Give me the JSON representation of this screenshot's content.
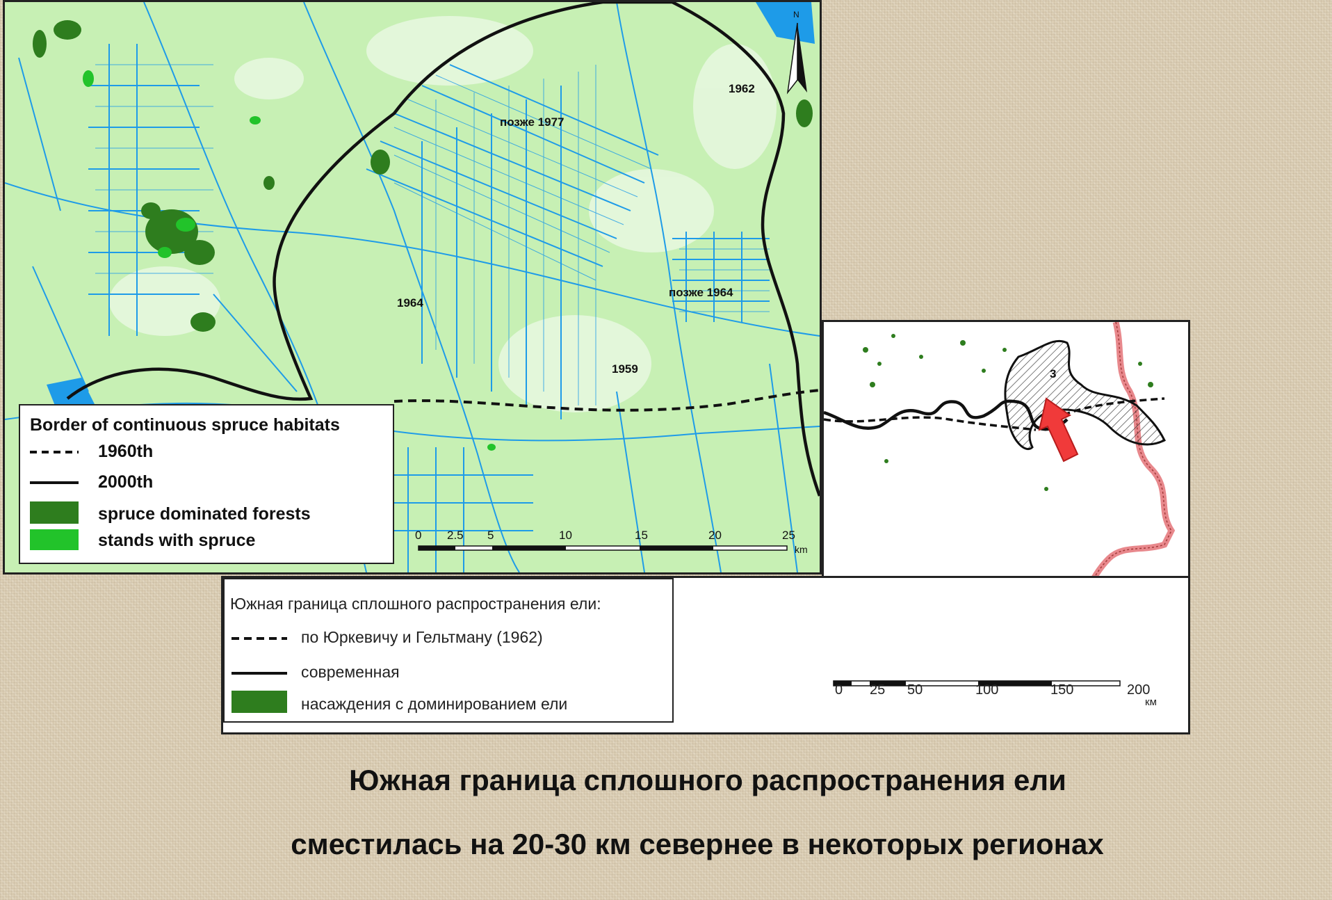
{
  "left_map": {
    "labels": [
      "позже 1977",
      "1962",
      "1964",
      "позже 1964",
      "1959"
    ],
    "north_label": "N",
    "scale": {
      "ticks": [
        "0",
        "2.5",
        "5",
        "10",
        "15",
        "20",
        "25"
      ],
      "unit": "km"
    },
    "legend": {
      "title": "Border of continuous spruce habitats",
      "items": [
        {
          "symbol": "dashed-line",
          "label": "1960th"
        },
        {
          "symbol": "solid-line",
          "label": "2000th"
        },
        {
          "symbol": "swatch",
          "color": "#2e7d1e",
          "label": "spruce dominated forests"
        },
        {
          "symbol": "swatch",
          "color": "#22c32a",
          "label": "stands with spruce"
        }
      ]
    },
    "colors": {
      "background": "#c7f0b4",
      "water": "#1e9be8",
      "spruce_dark": "#2e7d1e",
      "spruce_light": "#22c32a"
    }
  },
  "right_map": {
    "label": "3",
    "scale": {
      "ticks": [
        "0",
        "25",
        "50",
        "100",
        "150",
        "200"
      ],
      "unit": "км"
    },
    "colors": {
      "border": "#e8888c",
      "arrow": "#f03a3a"
    }
  },
  "right_legend": {
    "title": "Южная граница сплошного распространения ели:",
    "items": [
      {
        "symbol": "dashed-line",
        "label": "по Юркевичу и Гельтману (1962)"
      },
      {
        "symbol": "solid-line",
        "label": "современная"
      },
      {
        "symbol": "swatch",
        "color": "#2e7d1e",
        "label": "насаждения с доминированием ели"
      }
    ]
  },
  "caption": {
    "line1": "Южная граница сплошного распространения ели",
    "line2": "сместилась на 20-30 км севернее в некоторых регионах"
  }
}
